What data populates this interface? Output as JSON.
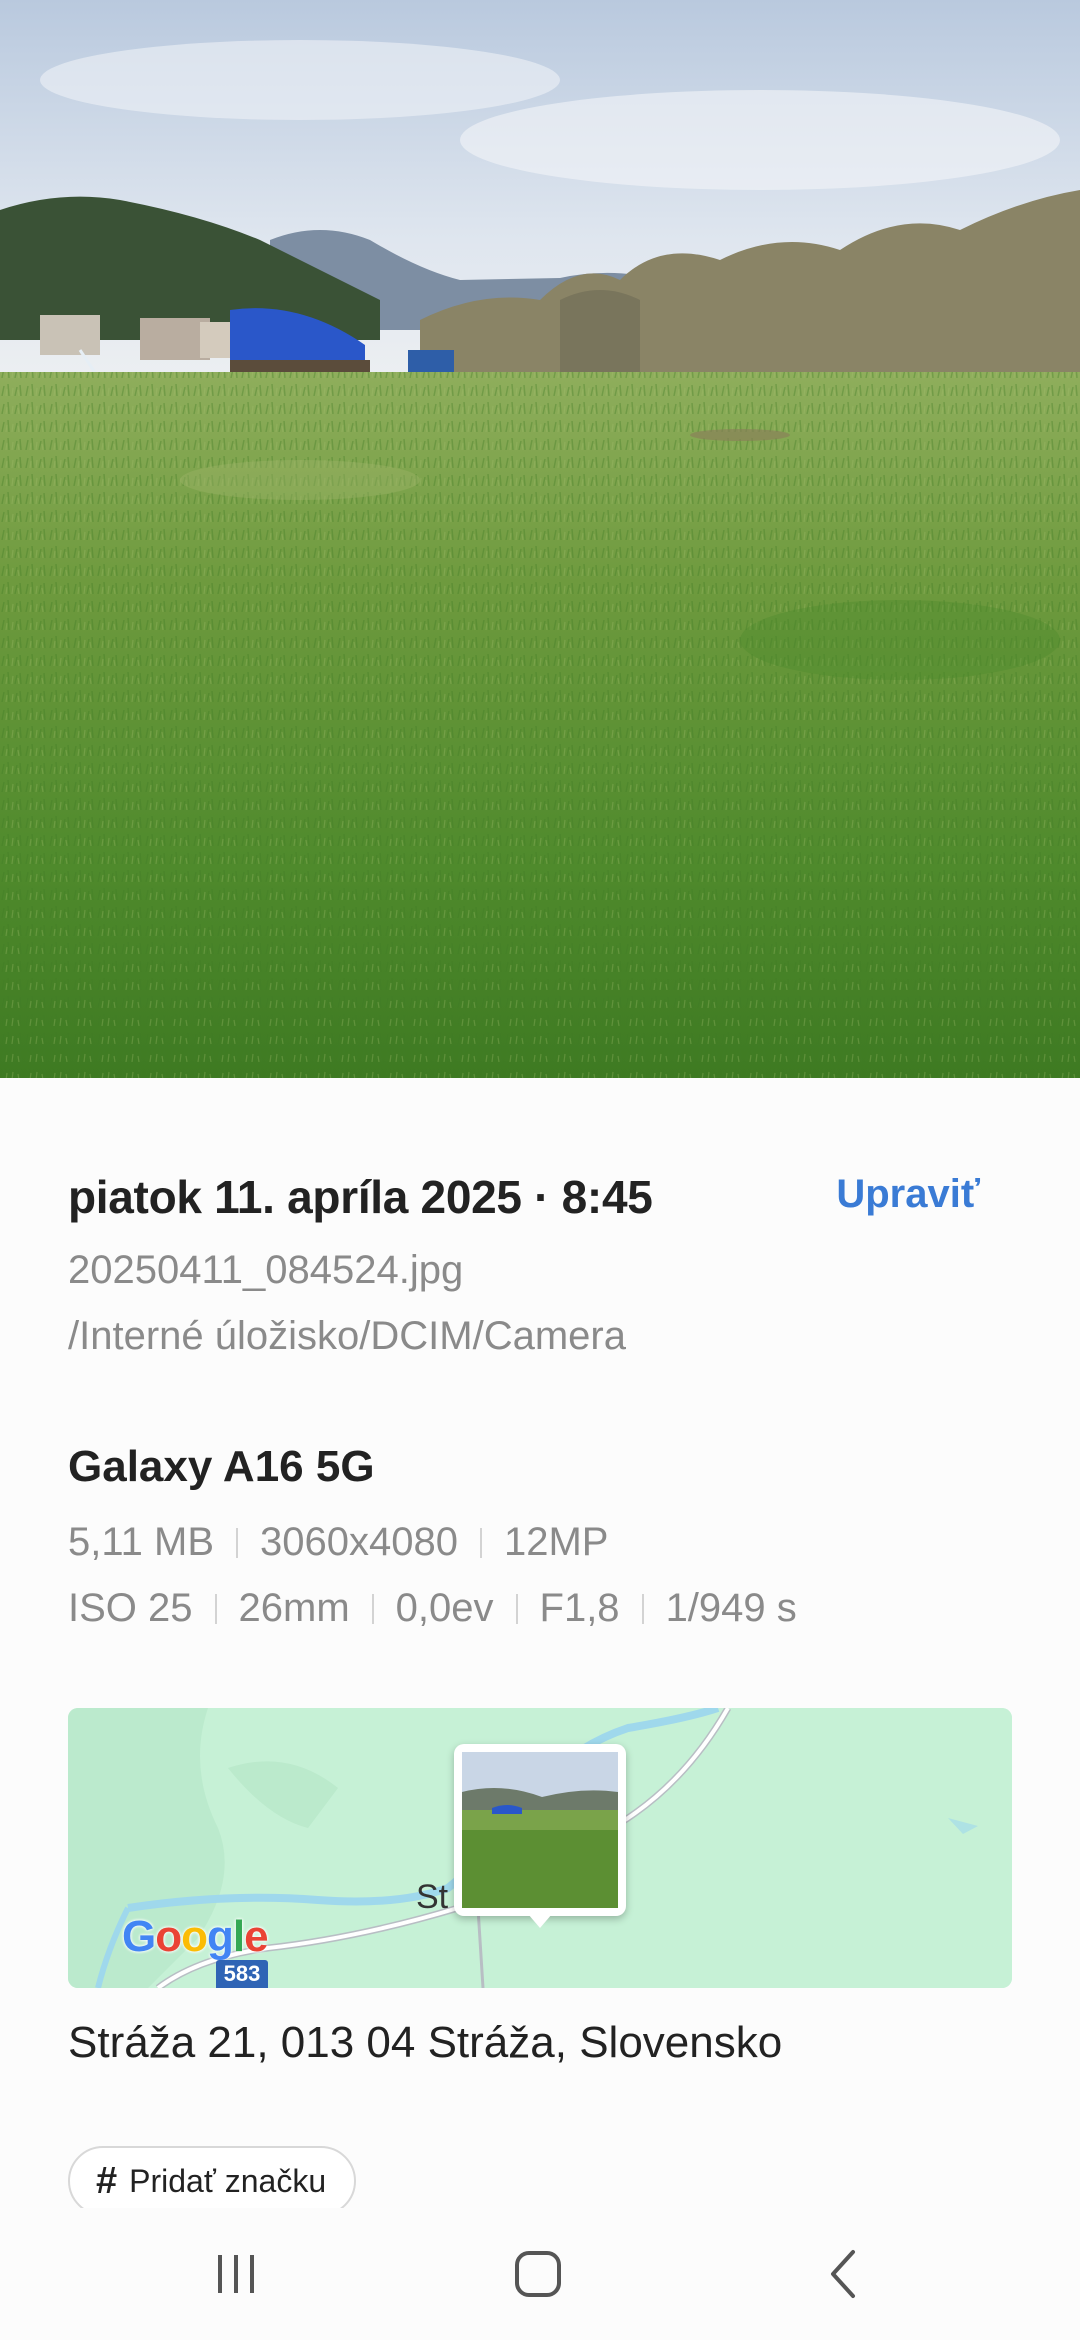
{
  "photo": {
    "subject": "grass-field-landscape"
  },
  "details": {
    "date_time": "piatok 11. apríla 2025 · 8:45",
    "edit_label": "Upraviť",
    "file_name": "20250411_084524.jpg",
    "file_path": "/Interné úložisko/DCIM/Camera",
    "device": "Galaxy A16 5G",
    "file_info": {
      "size": "5,11 MB",
      "resolution": "3060x4080",
      "megapixels": "12MP"
    },
    "exif": {
      "iso": "ISO 25",
      "focal_length": "26mm",
      "exposure_comp": "0,0ev",
      "aperture": "F1,8",
      "shutter": "1/949 s"
    },
    "map": {
      "town_label": "St",
      "logo_text": [
        "G",
        "o",
        "o",
        "g",
        "l",
        "e"
      ],
      "logo_colors": [
        "#4285F4",
        "#EA4335",
        "#FBBC05",
        "#4285F4",
        "#34A853",
        "#EA4335"
      ],
      "road_number": "583"
    },
    "address": "Stráža 21, 013 04 Stráža, Slovensko",
    "add_tag_label": "Pridať značku"
  },
  "navbar": {
    "recent_icon": "recent-apps-icon",
    "home_icon": "home-icon",
    "back_icon": "back-icon"
  },
  "colors": {
    "accent": "#3a7bd5",
    "map_bg": "#c6f1d6",
    "text_primary": "#222222",
    "text_secondary": "#8a8a8a"
  }
}
